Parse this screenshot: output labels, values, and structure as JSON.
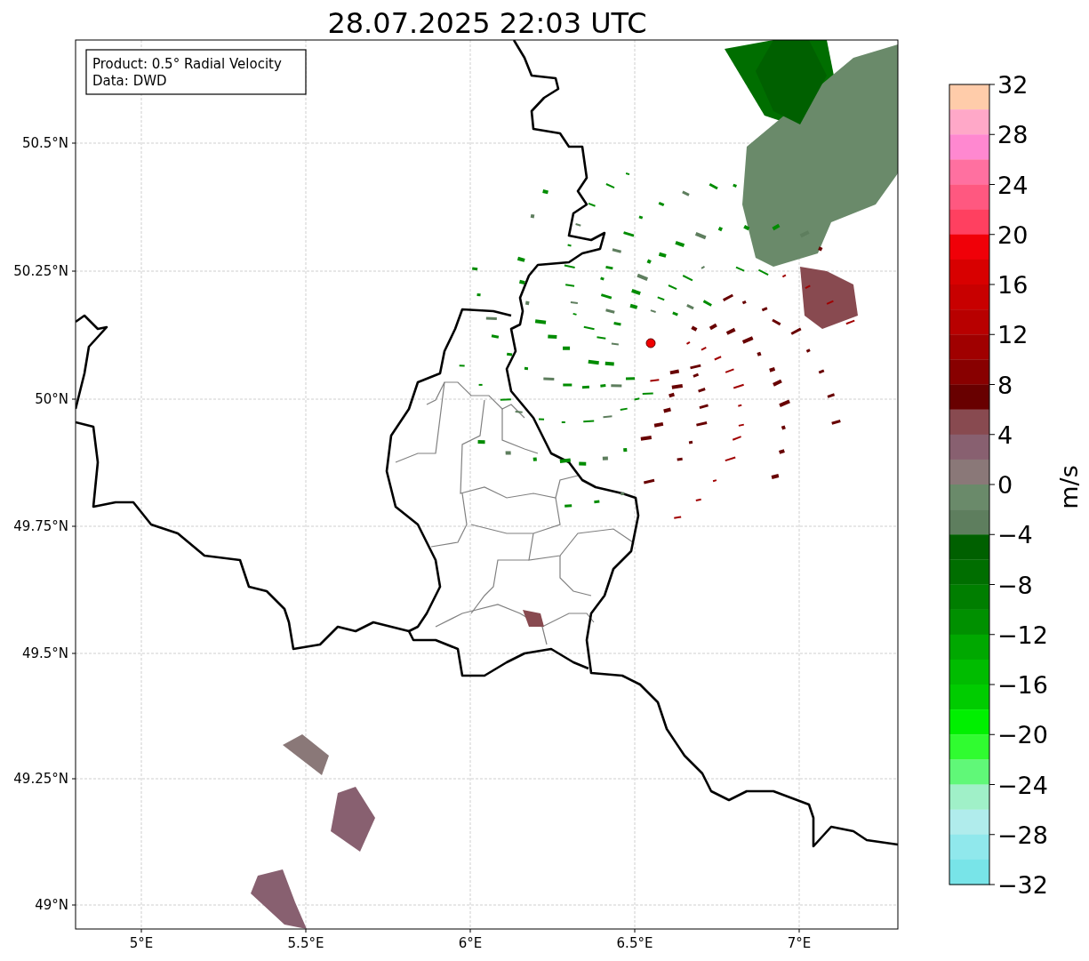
{
  "title": "28.07.2025 22:03 UTC",
  "info_box": [
    "Product: 0.5° Radial Velocity",
    "Data: DWD"
  ],
  "x_tick_labels": [
    "5°E",
    "5.5°E",
    "6°E",
    "6.5°E",
    "7°E"
  ],
  "y_tick_labels": [
    "50.5°N",
    "50.25°N",
    "50°N",
    "49.75°N",
    "49.5°N",
    "49.25°N",
    "49°N"
  ],
  "colorbar": {
    "label": "m/s",
    "tick_labels": [
      "32",
      "28",
      "24",
      "20",
      "16",
      "12",
      "8",
      "4",
      "0",
      "−4",
      "−8",
      "−12",
      "−16",
      "−20",
      "−24",
      "−28",
      "−32"
    ],
    "bands": [
      {
        "color": "#ffccaa"
      },
      {
        "color": "#ffa8c8"
      },
      {
        "color": "#ff88d0"
      },
      {
        "color": "#ff70a0"
      },
      {
        "color": "#ff5880"
      },
      {
        "color": "#ff4060"
      },
      {
        "color": "#f00008"
      },
      {
        "color": "#d80000"
      },
      {
        "color": "#c80000"
      },
      {
        "color": "#b80000"
      },
      {
        "color": "#a00000"
      },
      {
        "color": "#880000"
      },
      {
        "color": "#680000"
      },
      {
        "color": "#884a50"
      },
      {
        "color": "#886070"
      },
      {
        "color": "#8a7878"
      },
      {
        "color": "#6a8a6a"
      },
      {
        "color": "#5e7e5e"
      },
      {
        "color": "#006000"
      },
      {
        "color": "#006e00"
      },
      {
        "color": "#007e00"
      },
      {
        "color": "#009000"
      },
      {
        "color": "#00a800"
      },
      {
        "color": "#00bc00"
      },
      {
        "color": "#00cc00"
      },
      {
        "color": "#00f000"
      },
      {
        "color": "#30fc30"
      },
      {
        "color": "#60f878"
      },
      {
        "color": "#a0f0c8"
      },
      {
        "color": "#b0ecec"
      },
      {
        "color": "#90e8ec"
      },
      {
        "color": "#78e4e8"
      }
    ]
  }
}
